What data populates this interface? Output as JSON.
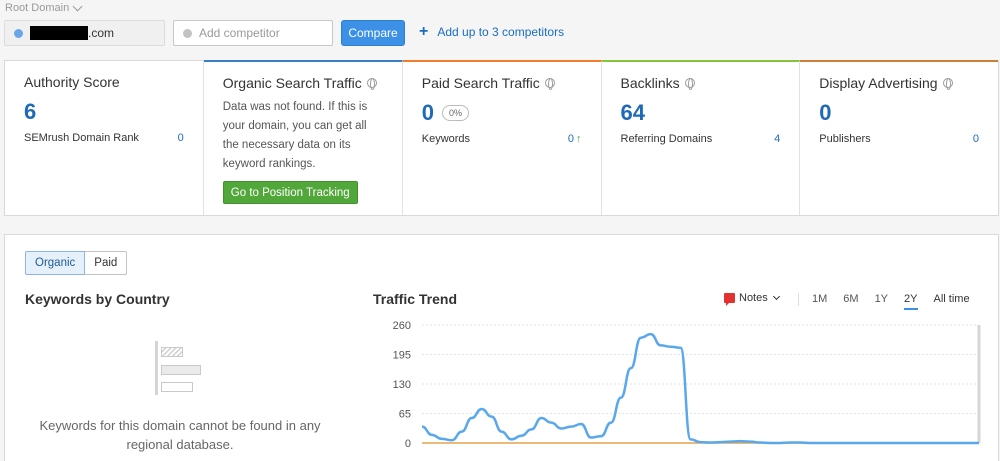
{
  "top_bar": {
    "root_domain_label": "Root Domain",
    "domain_suffix": ".com",
    "competitor_placeholder": "Add competitor",
    "compare_label": "Compare",
    "add_competitors_label": "Add up to 3 competitors"
  },
  "metrics": [
    {
      "title": "Authority Score",
      "value": "6",
      "sub_label": "SEMrush Domain Rank",
      "sub_value": "0"
    },
    {
      "title": "Organic Search Traffic",
      "description": "Data was not found. If this is your domain, you can get all the necessary data on its keyword rankings.",
      "button_label": "Go to Position Tracking"
    },
    {
      "title": "Paid Search Traffic",
      "value": "0",
      "badge": "0%",
      "sub_label": "Keywords",
      "sub_value": "0"
    },
    {
      "title": "Backlinks",
      "value": "64",
      "sub_label": "Referring Domains",
      "sub_value": "4"
    },
    {
      "title": "Display Advertising",
      "value": "0",
      "sub_label": "Publishers",
      "sub_value": "0"
    }
  ],
  "colors": {
    "accent_blue": "#3c91e6",
    "value_blue": "#1f6ab7",
    "green_button": "#52a73a",
    "traffic_line": "#5aa8ec",
    "paid_line": "#e6a34a"
  },
  "tabs": {
    "organic": "Organic",
    "paid": "Paid"
  },
  "keywords_by_country": {
    "title": "Keywords by Country",
    "empty_message": "Keywords for this domain cannot be found in any regional database."
  },
  "traffic_trend": {
    "title": "Traffic Trend",
    "notes_label": "Notes",
    "ranges": [
      "1M",
      "6M",
      "1Y",
      "2Y",
      "All time"
    ],
    "selected_range": "2Y"
  },
  "chart_data": {
    "type": "line",
    "title": "Traffic Trend",
    "yticks": [
      260,
      195,
      130,
      65,
      0
    ],
    "ylim": [
      0,
      260
    ],
    "x": [
      0,
      1,
      2,
      3,
      4,
      5,
      6,
      7,
      8,
      9,
      10,
      11,
      12,
      13,
      14,
      15,
      16,
      17,
      18,
      19,
      20,
      21,
      22,
      23,
      24,
      25,
      26,
      27,
      28,
      29,
      30,
      31,
      32,
      33,
      34,
      35,
      36,
      37,
      38,
      39,
      40,
      41,
      42,
      43,
      44,
      45,
      46,
      47,
      48,
      49,
      50,
      51,
      52,
      53,
      54,
      55,
      56
    ],
    "series": [
      {
        "values": [
          36,
          18,
          9,
          6,
          25,
          55,
          75,
          58,
          25,
          8,
          16,
          30,
          55,
          45,
          32,
          36,
          42,
          12,
          15,
          45,
          100,
          165,
          232,
          240,
          215,
          212,
          210,
          8,
          2,
          1,
          2,
          3,
          4,
          3,
          1,
          0,
          0,
          1,
          1,
          0,
          0,
          0,
          0,
          0,
          0,
          0,
          0,
          0,
          0,
          0,
          0,
          0,
          0,
          0,
          0,
          0,
          0
        ]
      },
      {
        "values": [
          0,
          0,
          0,
          0,
          0,
          0,
          0,
          0,
          0,
          0,
          0,
          0,
          0,
          0,
          0,
          0,
          0,
          0,
          0,
          0,
          0,
          0,
          0,
          0,
          0,
          0,
          0,
          0,
          0,
          0,
          0,
          0,
          0,
          0,
          0,
          0,
          0,
          0,
          0,
          0,
          0,
          0,
          0,
          0,
          0,
          0,
          0,
          0,
          0,
          0,
          0,
          0,
          0,
          0,
          0,
          0,
          0
        ]
      }
    ]
  }
}
